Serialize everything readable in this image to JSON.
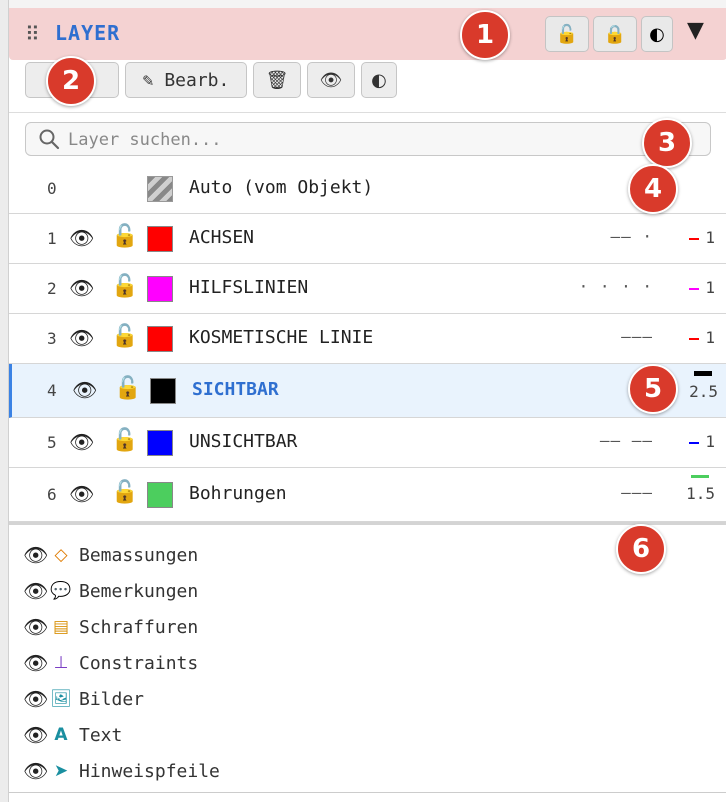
{
  "header": {
    "title": "LAYER",
    "buttons": [
      {
        "icon": "unlock-icon",
        "glyph": "🔓"
      },
      {
        "icon": "lock-icon",
        "glyph": "🔒"
      },
      {
        "icon": "contrast-icon",
        "glyph": "◐"
      }
    ],
    "collapse_glyph": "▼"
  },
  "toolbar": {
    "add_glyph": "+",
    "edit_label": "✎ Bearb.",
    "delete_glyph": "🗑",
    "visibility_glyph": "👁",
    "contrast_glyph": "◐"
  },
  "search": {
    "placeholder": "Layer suchen..."
  },
  "layers": [
    {
      "num": "0",
      "name": "Auto (vom Objekt)",
      "color": "auto",
      "linetype": "",
      "lineweight": "",
      "lw_color": "",
      "eye": "",
      "lock": ""
    },
    {
      "num": "1",
      "name": "ACHSEN",
      "color": "#ff0000",
      "linetype": "—— ·",
      "lineweight": "1",
      "lw_color": "#ff0000",
      "eye": "👁",
      "lock": "🔓"
    },
    {
      "num": "2",
      "name": "HILFSLINIEN",
      "color": "#ff00ff",
      "linetype": "· · · ·",
      "lineweight": "1",
      "lw_color": "#ff00ff",
      "eye": "👁",
      "lock": "🔓"
    },
    {
      "num": "3",
      "name": "KOSMETISCHE LINIE",
      "color": "#ff0000",
      "linetype": "———",
      "lineweight": "1",
      "lw_color": "#ff0000",
      "eye": "👁",
      "lock": "🔓"
    },
    {
      "num": "4",
      "name": "SICHTBAR",
      "color": "#000000",
      "linetype": "——",
      "lineweight": "2.5",
      "lw_color": "#000000",
      "eye": "👁",
      "lock": "🔓",
      "selected": true
    },
    {
      "num": "5",
      "name": "UNSICHTBAR",
      "color": "#0000ff",
      "linetype": "—— ——",
      "lineweight": "1",
      "lw_color": "#0000ff",
      "eye": "👁",
      "lock": "🔓"
    },
    {
      "num": "6",
      "name": "Bohrungen",
      "color": "#4cce5e",
      "linetype": "———",
      "lineweight": "1.5",
      "lw_color": "#4cce5e",
      "eye": "👁",
      "lock": "🔓"
    }
  ],
  "extras": [
    {
      "label": "Bemassungen",
      "icon": "diamond-icon",
      "glyph": "◇",
      "color": "#e07b00"
    },
    {
      "label": "Bemerkungen",
      "icon": "speech-bubble-icon",
      "glyph": "💬",
      "color": "#333333"
    },
    {
      "label": "Schraffuren",
      "icon": "hatch-icon",
      "glyph": "▤",
      "color": "#d9920a"
    },
    {
      "label": "Constraints",
      "icon": "perpendicular-icon",
      "glyph": "⊥",
      "color": "#7b3fc4"
    },
    {
      "label": "Bilder",
      "icon": "image-icon",
      "glyph": "🖼",
      "color": "#1a8fa0"
    },
    {
      "label": "Text",
      "icon": "text-icon",
      "glyph": "A",
      "color": "#1a8fa0"
    },
    {
      "label": "Hinweispfeile",
      "icon": "arrow-icon",
      "glyph": "➤",
      "color": "#1a8fa0"
    }
  ],
  "badges": [
    "1",
    "2",
    "3",
    "4",
    "5",
    "6"
  ],
  "colors": {
    "accent": "#2f6fd0",
    "header_bg": "#f4d2d2",
    "badge": "#d93a2b"
  }
}
